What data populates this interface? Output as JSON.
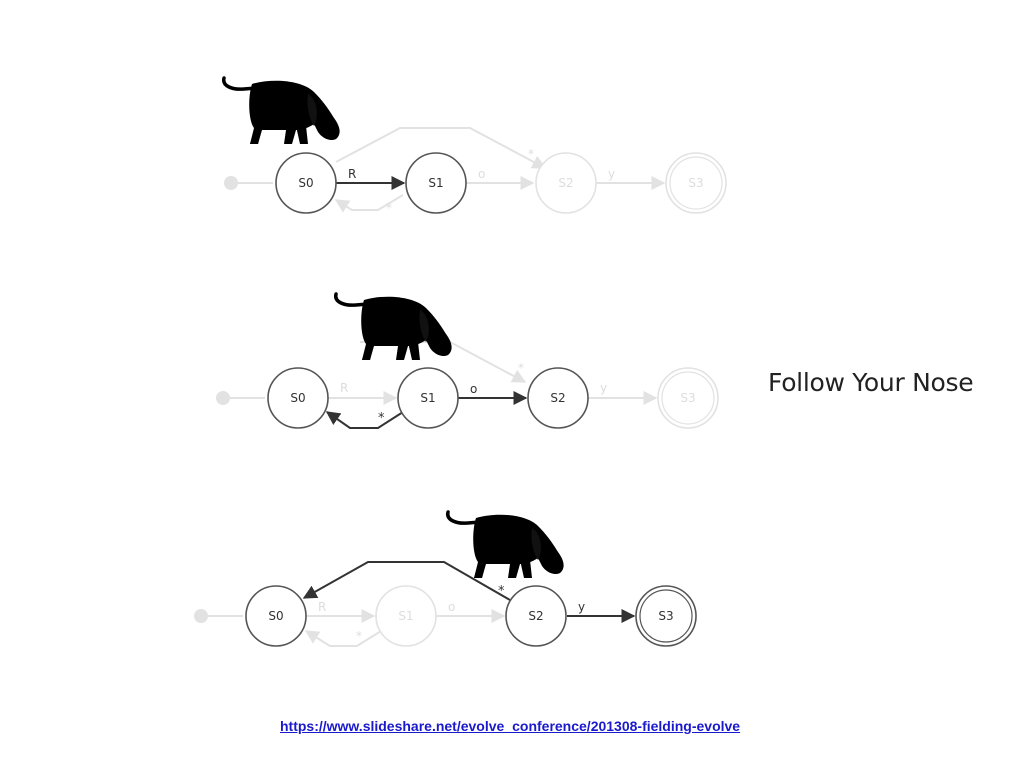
{
  "slide": {
    "title": "Follow Your Nose",
    "link": "https://www.slideshare.net/evolve_conference/201308-fielding-evolve"
  },
  "states": [
    "S0",
    "S1",
    "S2",
    "S3"
  ],
  "transition_labels": {
    "s0_s1": "R",
    "s1_s2": "o",
    "s2_s3": "y",
    "back": "*"
  },
  "diagrams": [
    {
      "active_state": "S0",
      "active_transition": "R"
    },
    {
      "active_state": "S1",
      "active_transition": "o",
      "back_transition": "*"
    },
    {
      "active_state": "S2",
      "active_transition": "y",
      "back_transition": "*"
    }
  ],
  "colors": {
    "active": "#555555",
    "faded": "#e2e2e2",
    "dog": "#000000",
    "link": "#1a1acc"
  }
}
